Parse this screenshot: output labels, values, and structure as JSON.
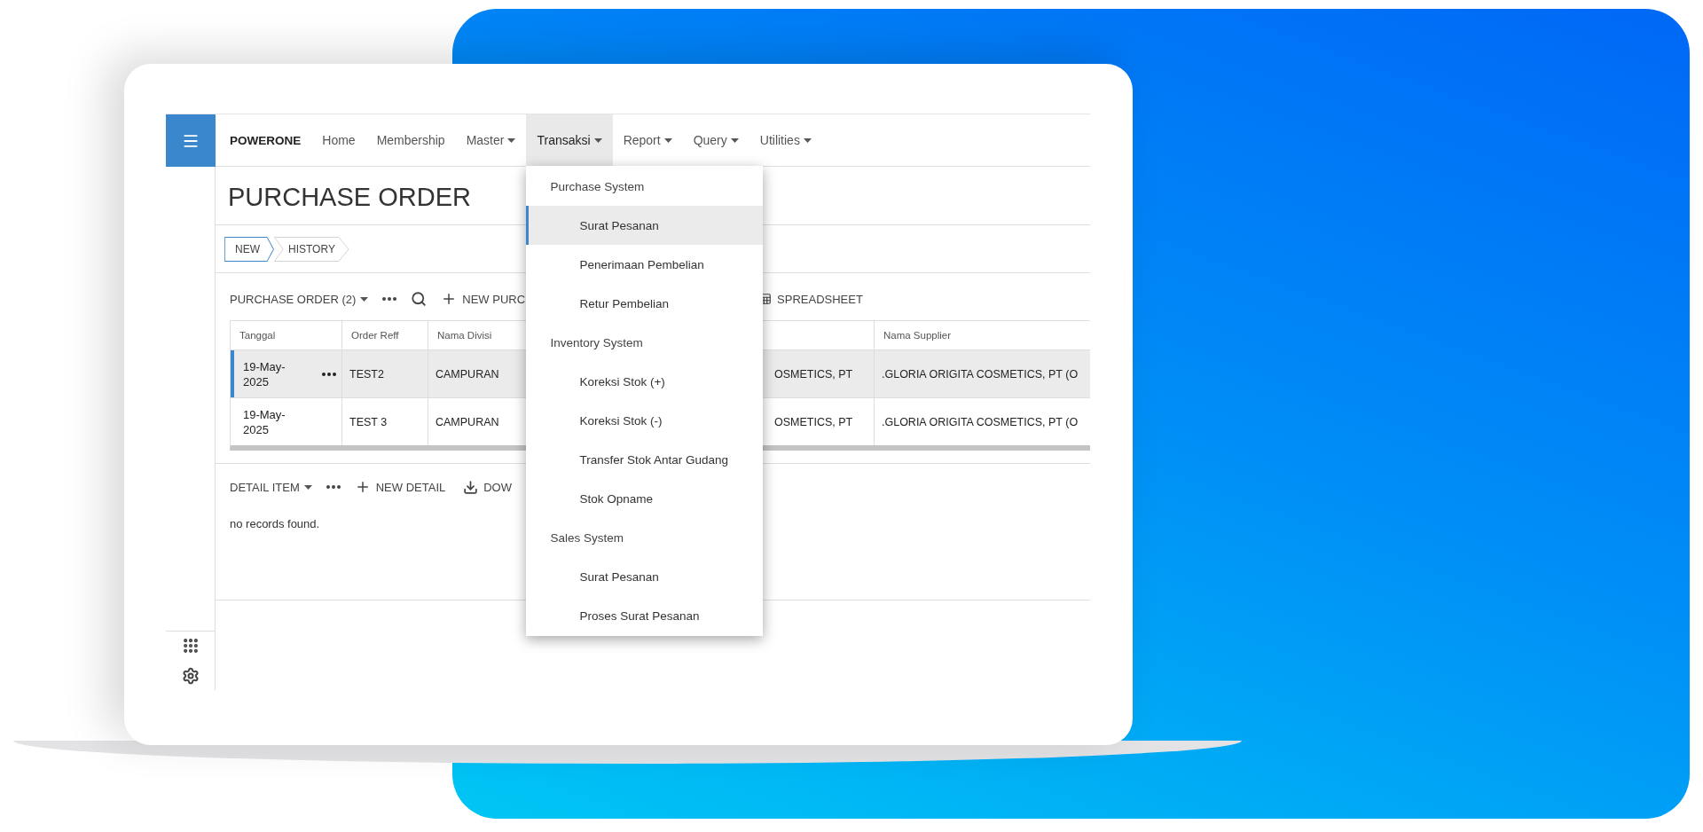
{
  "brand": "POWERONE",
  "nav": [
    {
      "label": "Home",
      "dropdown": false,
      "selected": false
    },
    {
      "label": "Membership",
      "dropdown": false,
      "selected": false
    },
    {
      "label": "Master",
      "dropdown": true,
      "selected": false
    },
    {
      "label": "Transaksi",
      "dropdown": true,
      "selected": true
    },
    {
      "label": "Report",
      "dropdown": true,
      "selected": false
    },
    {
      "label": "Query",
      "dropdown": true,
      "selected": false
    },
    {
      "label": "Utilities",
      "dropdown": true,
      "selected": false
    }
  ],
  "menu": {
    "groups": [
      {
        "label": "Purchase System",
        "items": [
          {
            "label": "Surat Pesanan",
            "selected": true
          },
          {
            "label": "Penerimaan Pembelian",
            "selected": false
          },
          {
            "label": "Retur Pembelian",
            "selected": false
          }
        ]
      },
      {
        "label": "Inventory System",
        "items": [
          {
            "label": "Koreksi Stok (+)",
            "selected": false
          },
          {
            "label": "Koreksi Stok (-)",
            "selected": false
          },
          {
            "label": "Transfer Stok Antar Gudang",
            "selected": false
          },
          {
            "label": "Stok Opname",
            "selected": false
          }
        ]
      },
      {
        "label": "Sales System",
        "items": [
          {
            "label": "Surat Pesanan",
            "selected": false
          },
          {
            "label": "Proses Surat Pesanan",
            "selected": false
          }
        ]
      }
    ]
  },
  "page_title": "PURCHASE ORDER",
  "steps": [
    {
      "label": "NEW",
      "selected": true
    },
    {
      "label": "HISTORY",
      "selected": false
    }
  ],
  "toolbar": {
    "title": "PURCHASE ORDER (2)",
    "new_button": "NEW PURC",
    "spreadsheet_button": "SPREADSHEET"
  },
  "table": {
    "columns": [
      "Tanggal",
      "Order Reff",
      "Nama Divisi",
      "",
      "Nama Supplier"
    ],
    "rows": [
      {
        "selected": true,
        "cells": [
          "19-May-2025",
          "TEST2",
          "CAMPURAN",
          "OSMETICS, PT",
          ".GLORIA ORIGITA COSMETICS, PT (O"
        ]
      },
      {
        "selected": false,
        "cells": [
          "19-May-2025",
          "TEST 3",
          "CAMPURAN",
          "OSMETICS, PT",
          ".GLORIA ORIGITA COSMETICS, PT (O"
        ]
      }
    ]
  },
  "detail": {
    "title": "DETAIL ITEM",
    "new_button": "NEW DETAIL",
    "download_button": "DOW",
    "empty_message": "no records found."
  }
}
